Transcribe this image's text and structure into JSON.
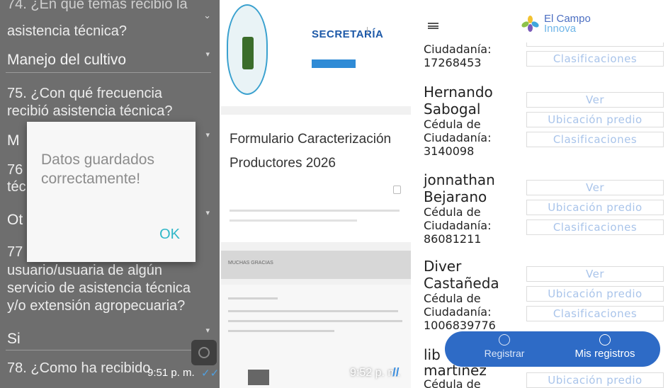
{
  "panel1": {
    "q74_partial": "74. ¿En qué temas recibió la",
    "q74_tail": "asistencia técnica?",
    "a74": "Manejo del cultivo",
    "q75": "75. ¿Con qué frecuencia recibió asistencia técnica?",
    "a75_partial": "M",
    "q76_partial": "76",
    "q76_tail": "téc",
    "a76_partial": "Ot",
    "q77_partial": "77",
    "q77_tail": "usuario/usuaria de algún servicio de asistencia técnica y/o extensión agropecuaria?",
    "a77": "Si",
    "q78": "78. ¿Como ha recibido",
    "dialog_message": "Datos guardados correctamente!",
    "dialog_ok": "OK",
    "time": "9:51 p. m.",
    "check": "✓✓"
  },
  "panel2": {
    "org_title": "SECRETARÍA",
    "form_title": "Formulario Caracterización Productores 2026",
    "section_label": "MUCHAS GRACIAS",
    "time": "9:52 p. m.",
    "check": "//"
  },
  "panel3": {
    "app_title_1": "El Campo",
    "app_title_2": "Innova",
    "btn_ver": "Ver",
    "btn_ubicacion": "Ubicación predio",
    "btn_clasificaciones": "Clasificaciones",
    "records": [
      {
        "name1": "",
        "name2": "",
        "ci1": "Ciudadanía:",
        "ci2": "17268453"
      },
      {
        "name1": "Hernando",
        "name2": "Sabogal",
        "ci1": "Cédula de",
        "ci2": "Ciudadanía:",
        "ci3": "3140098"
      },
      {
        "name1": "jonnathan",
        "name2": "Bejarano",
        "ci1": "Cédula de",
        "ci2": "Ciudadanía:",
        "ci3": "86081211"
      },
      {
        "name1": "Diver",
        "name2": "Castañeda",
        "ci1": "Cédula de",
        "ci2": "Ciudadanía:",
        "ci3": "1006839776"
      }
    ],
    "partial_name1": "lib",
    "partial_name2": "martinez",
    "partial_ci": "Cédula de",
    "fab_register": "Registrar",
    "fab_my_records": "Mis registros"
  },
  "colors": {
    "accent": "#2e6bc6",
    "button_text": "#a9c4ea",
    "dialog_ok": "#2fb7c8"
  }
}
